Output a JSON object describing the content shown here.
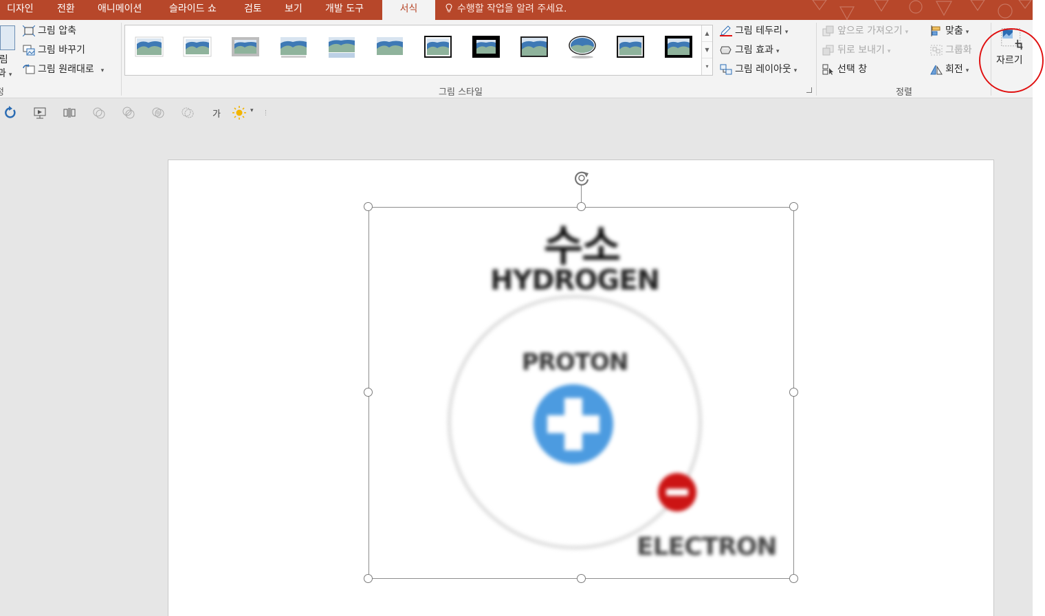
{
  "tabs": [
    {
      "label": "디자인",
      "active": false
    },
    {
      "label": "전환",
      "active": false
    },
    {
      "label": "애니메이션",
      "active": false
    },
    {
      "label": "슬라이드 쇼",
      "active": false
    },
    {
      "label": "검토",
      "active": false
    },
    {
      "label": "보기",
      "active": false
    },
    {
      "label": "개발 도구",
      "active": false
    },
    {
      "label": "서식",
      "active": true
    }
  ],
  "tell_me": "수행할 작업을 알려 주세요.",
  "colors": {
    "accent": "#b7472a",
    "ribbon_bg": "#f3f3f3",
    "canvas_bg": "#e6e6e6",
    "highlight": "#e01010",
    "proton": "#4c9be0",
    "electron": "#cc1414"
  },
  "ribbon": {
    "adjust": {
      "partial_label_top": "그림",
      "partial_label_bottom": "과",
      "group_label_partial": "정",
      "compress": "그림 압축",
      "change": "그림 바꾸기",
      "reset": "그림 원래대로"
    },
    "styles": {
      "group_label": "그림 스타일",
      "border": "그림 테두리",
      "effects": "그림 효과",
      "layout": "그림 레이아웃",
      "thumbnail_count": 12
    },
    "arrange": {
      "group_label": "정렬",
      "bring_forward": "앞으로 가져오기",
      "send_backward": "뒤로 보내기",
      "selection_pane": "선택 창",
      "align": "맞춤",
      "group": "그룹화",
      "rotate": "회전"
    },
    "size": {
      "crop": "자르기"
    }
  },
  "quick_toolbar": {
    "text_icon": "가"
  },
  "slide": {
    "title_ko": "수소",
    "title_en": "HYDROGEN",
    "proton_label": "PROTON",
    "electron_label": "ELECTRON"
  }
}
